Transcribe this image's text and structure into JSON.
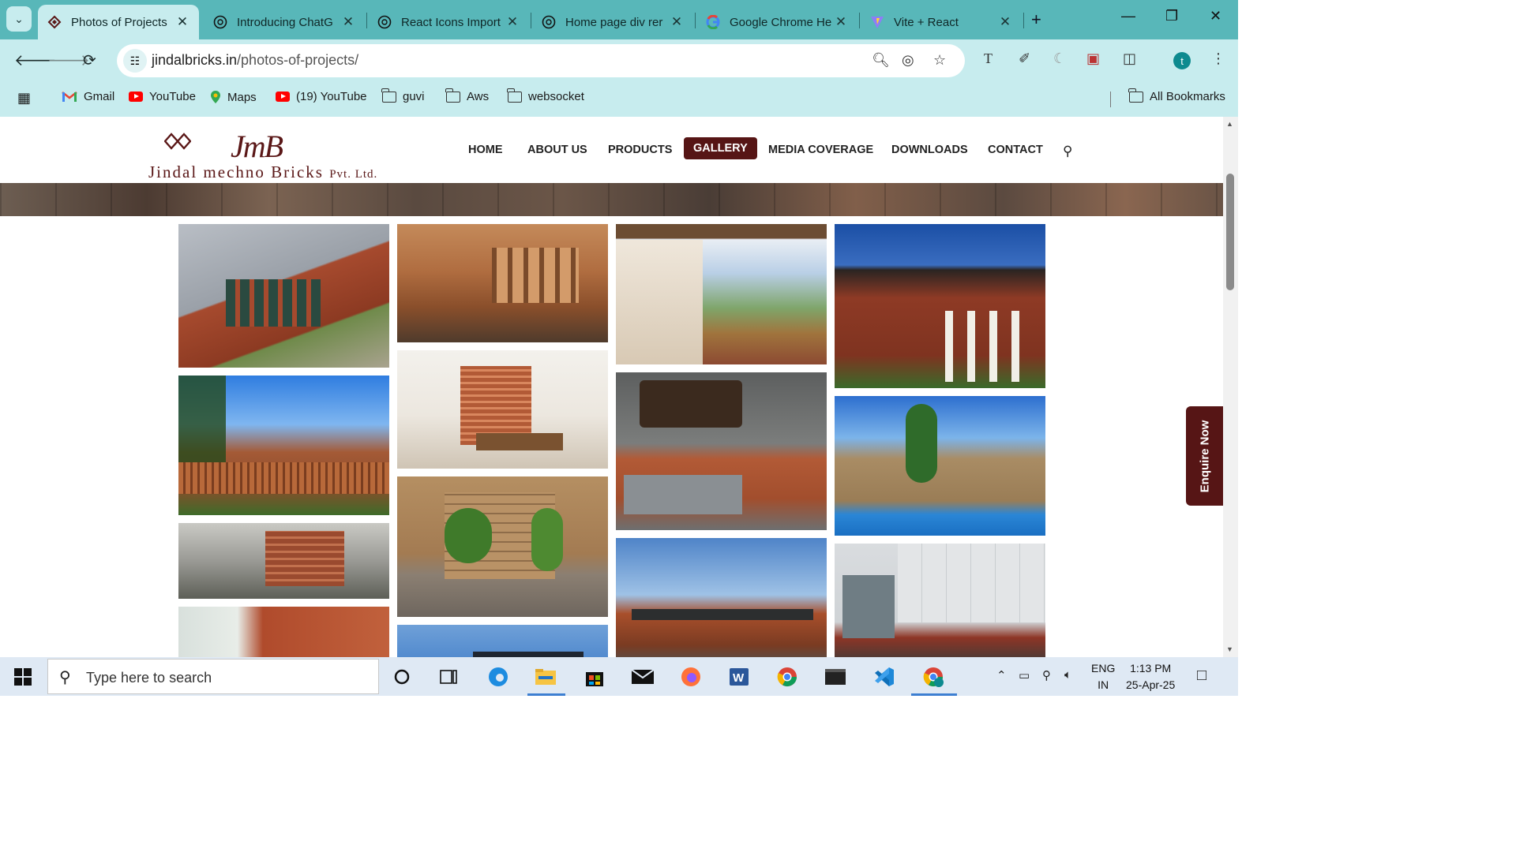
{
  "browser": {
    "tabs": [
      {
        "title": "Photos of Projects",
        "favicon": "jmb-favicon",
        "active": true
      },
      {
        "title": "Introducing ChatG",
        "favicon": "chatgpt-icon",
        "active": false
      },
      {
        "title": "React Icons Import",
        "favicon": "chatgpt-icon",
        "active": false
      },
      {
        "title": "Home page div rer",
        "favicon": "chatgpt-icon",
        "active": false
      },
      {
        "title": "Google Chrome He",
        "favicon": "google-icon",
        "active": false
      },
      {
        "title": "Vite + React",
        "favicon": "vite-icon",
        "active": false
      }
    ],
    "new_tab": "+",
    "url_host": "jindalbricks.in",
    "url_path": "/photos-of-projects/",
    "avatar_letter": "t",
    "bookmarks": [
      {
        "label": "Gmail",
        "icon": "gmail-icon"
      },
      {
        "label": "YouTube",
        "icon": "youtube-icon"
      },
      {
        "label": "Maps",
        "icon": "maps-icon"
      },
      {
        "label": "(19) YouTube",
        "icon": "youtube-icon"
      },
      {
        "label": "guvi",
        "icon": "folder-icon"
      },
      {
        "label": "Aws",
        "icon": "folder-icon"
      },
      {
        "label": "websocket",
        "icon": "folder-icon"
      }
    ],
    "all_bookmarks": "All Bookmarks",
    "accent": "#58b7b9",
    "toolbar_color": "#c7ecee"
  },
  "site": {
    "logo": {
      "monogram": "JmB",
      "name": "Jindal mechno Bricks",
      "suffix": "Pvt. Ltd."
    },
    "nav": [
      "HOME",
      "ABOUT US",
      "PRODUCTS",
      "GALLERY",
      "MEDIA COVERAGE",
      "DOWNLOADS",
      "CONTACT"
    ],
    "active_nav": "GALLERY",
    "brand_color": "#561515",
    "enquire": "Enquire Now",
    "gallery": [
      {
        "subject": "brick office building with glass",
        "column": 1
      },
      {
        "subject": "brick house with garden fence",
        "column": 1
      },
      {
        "subject": "brick jali facade building",
        "column": 1
      },
      {
        "subject": "brick wall corner",
        "column": 1
      },
      {
        "subject": "brick interior with stairs",
        "column": 2
      },
      {
        "subject": "dining room with brick staircase",
        "column": 2
      },
      {
        "subject": "brick patio with plants",
        "column": 2
      },
      {
        "subject": "building under blue sky",
        "column": 2
      },
      {
        "subject": "veranda with mountain view",
        "column": 3
      },
      {
        "subject": "cafe with brick wall",
        "column": 3
      },
      {
        "subject": "brick commercial building",
        "column": 3
      },
      {
        "subject": "red brick villa",
        "column": 4
      },
      {
        "subject": "pool with brick wall",
        "column": 4
      },
      {
        "subject": "white panel facade building",
        "column": 4
      }
    ]
  },
  "taskbar": {
    "search_placeholder": "Type here to search",
    "lang_line1": "ENG",
    "lang_line2": "IN",
    "time": "1:13 PM",
    "date": "25-Apr-25"
  }
}
